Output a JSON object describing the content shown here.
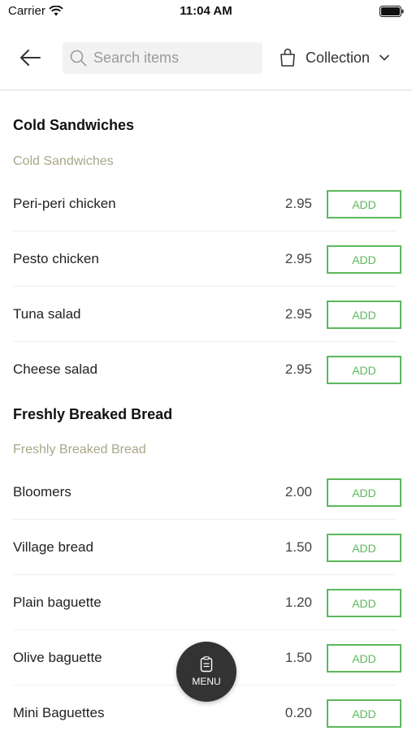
{
  "status": {
    "carrier": "Carrier",
    "time": "11:04 AM"
  },
  "header": {
    "search_placeholder": "Search items",
    "collection_label": "Collection"
  },
  "sections": [
    {
      "title": "Cold Sandwiches",
      "subtitle": "Cold Sandwiches",
      "items": [
        {
          "name": "Peri-peri chicken",
          "price": "2.95",
          "action": "ADD"
        },
        {
          "name": "Pesto chicken",
          "price": "2.95",
          "action": "ADD"
        },
        {
          "name": "Tuna salad",
          "price": "2.95",
          "action": "ADD"
        },
        {
          "name": "Cheese salad",
          "price": "2.95",
          "action": "ADD"
        }
      ]
    },
    {
      "title": "Freshly Breaked Bread",
      "subtitle": "Freshly Breaked Bread",
      "items": [
        {
          "name": "Bloomers",
          "price": "2.00",
          "action": "ADD"
        },
        {
          "name": "Village bread",
          "price": "1.50",
          "action": "ADD"
        },
        {
          "name": "Plain baguette",
          "price": "1.20",
          "action": "ADD"
        },
        {
          "name": "Olive baguette",
          "price": "1.50",
          "action": "ADD"
        },
        {
          "name": "Mini Baguettes",
          "price": "0.20",
          "action": "ADD"
        }
      ]
    }
  ],
  "fab": {
    "label": "MENU"
  },
  "colors": {
    "accent": "#5cb85c",
    "subtitle": "#a9a787",
    "fab": "#333333"
  }
}
